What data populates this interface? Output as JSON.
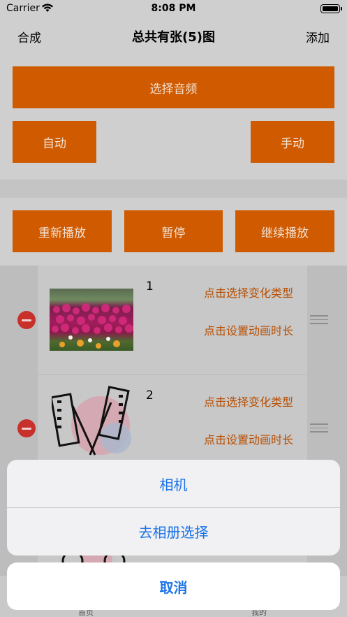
{
  "status_bar": {
    "carrier": "Carrier",
    "time": "8:08 PM"
  },
  "navbar": {
    "left": "合成",
    "title": "总共有张(5)图",
    "right": "添加"
  },
  "controls": {
    "select_audio": "选择音频",
    "auto": "自动",
    "manual": "手动",
    "replay": "重新播放",
    "pause": "暂停",
    "continue": "继续播放"
  },
  "list": {
    "items": [
      {
        "index": "1",
        "transition_link": "点击选择变化类型",
        "duration_link": "点击设置动画时长"
      },
      {
        "index": "2",
        "transition_link": "点击选择变化类型",
        "duration_link": "点击设置动画时长"
      }
    ]
  },
  "tab_bar": {
    "home": "首页",
    "mine": "我的"
  },
  "action_sheet": {
    "camera": "相机",
    "album": "去相册选择",
    "cancel": "取消"
  },
  "colors": {
    "accent": "#cf5a00",
    "link": "#b84e00",
    "sheet_text": "#1a73e8"
  }
}
